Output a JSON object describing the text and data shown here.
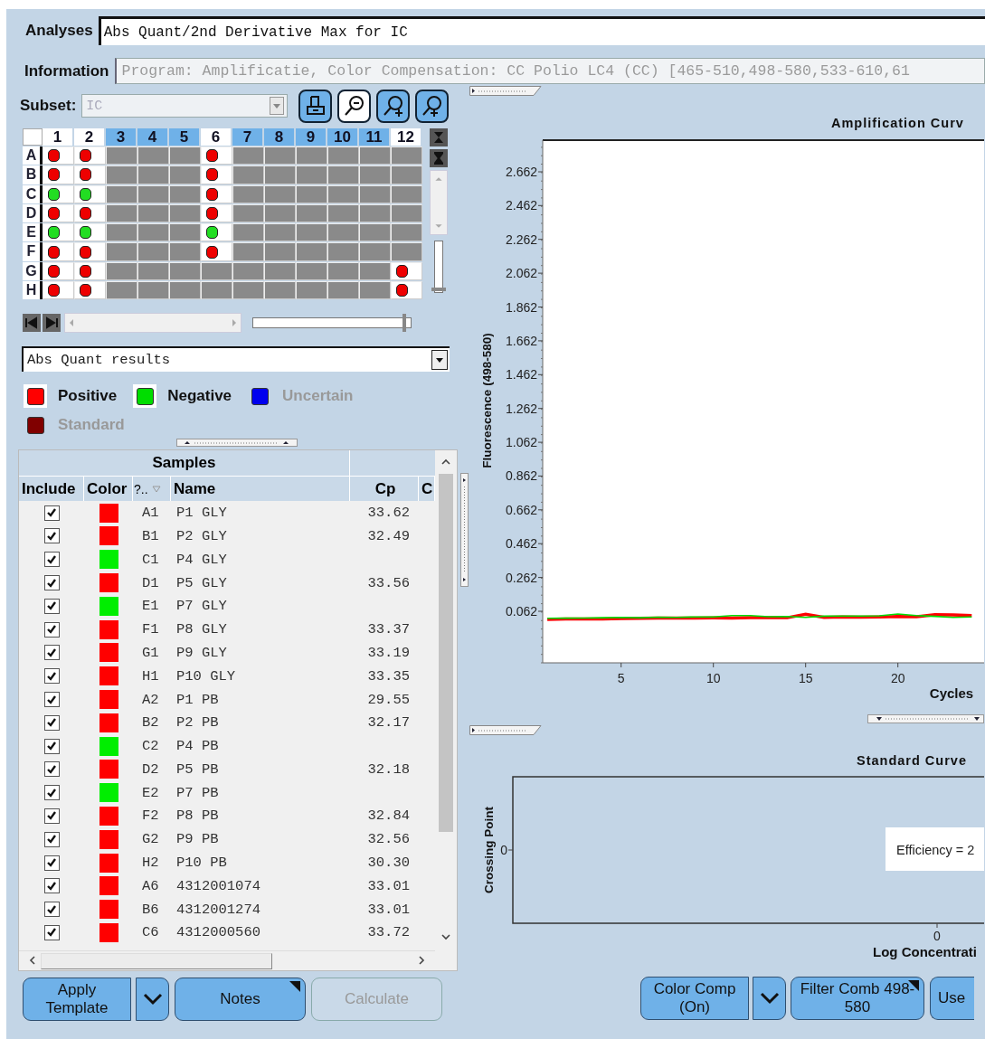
{
  "analyses": {
    "label": "Analyses",
    "value": "Abs Quant/2nd Derivative Max for IC"
  },
  "information": {
    "label": "Information",
    "value": "Program: Amplificatie, Color Compensation: CC Polio LC4 (CC) [465-510,498-580,533-610,61",
    "disabled": true
  },
  "subset": {
    "label": "Subset:",
    "value": "IC",
    "disabled": true
  },
  "toolbar": [
    {
      "kind": "print",
      "selected": false
    },
    {
      "kind": "zoom_out",
      "selected": true
    },
    {
      "kind": "zoom_in",
      "selected": false
    },
    {
      "kind": "zoom_pin",
      "selected": false
    }
  ],
  "plate": {
    "columns": [
      {
        "label": "1",
        "selected": true
      },
      {
        "label": "2",
        "selected": true
      },
      {
        "label": "3",
        "selected": false
      },
      {
        "label": "4",
        "selected": false
      },
      {
        "label": "5",
        "selected": false
      },
      {
        "label": "6",
        "selected": true
      },
      {
        "label": "7",
        "selected": false
      },
      {
        "label": "8",
        "selected": false
      },
      {
        "label": "9",
        "selected": false
      },
      {
        "label": "10",
        "selected": false
      },
      {
        "label": "11",
        "selected": false
      },
      {
        "label": "12",
        "selected": true
      }
    ],
    "rows": [
      {
        "label": "A",
        "wells": [
          {
            "kind": "sample",
            "color": "#ee0000"
          },
          {
            "kind": "sample",
            "color": "#ee0000"
          },
          {
            "kind": "empty"
          },
          {
            "kind": "empty"
          },
          {
            "kind": "empty"
          },
          {
            "kind": "sample",
            "color": "#ee0000"
          },
          {
            "kind": "empty"
          },
          {
            "kind": "empty"
          },
          {
            "kind": "empty"
          },
          {
            "kind": "empty"
          },
          {
            "kind": "empty"
          },
          {
            "kind": "empty"
          }
        ]
      },
      {
        "label": "B",
        "wells": [
          {
            "kind": "sample",
            "color": "#ee0000"
          },
          {
            "kind": "sample",
            "color": "#ee0000"
          },
          {
            "kind": "empty"
          },
          {
            "kind": "empty"
          },
          {
            "kind": "empty"
          },
          {
            "kind": "sample",
            "color": "#ee0000"
          },
          {
            "kind": "empty"
          },
          {
            "kind": "empty"
          },
          {
            "kind": "empty"
          },
          {
            "kind": "empty"
          },
          {
            "kind": "empty"
          },
          {
            "kind": "empty"
          }
        ]
      },
      {
        "label": "C",
        "wells": [
          {
            "kind": "sample",
            "color": "#22dd22"
          },
          {
            "kind": "sample",
            "color": "#22dd22"
          },
          {
            "kind": "empty"
          },
          {
            "kind": "empty"
          },
          {
            "kind": "empty"
          },
          {
            "kind": "sample",
            "color": "#ee0000"
          },
          {
            "kind": "empty"
          },
          {
            "kind": "empty"
          },
          {
            "kind": "empty"
          },
          {
            "kind": "empty"
          },
          {
            "kind": "empty"
          },
          {
            "kind": "empty"
          }
        ]
      },
      {
        "label": "D",
        "wells": [
          {
            "kind": "sample",
            "color": "#ee0000"
          },
          {
            "kind": "sample",
            "color": "#ee0000"
          },
          {
            "kind": "empty"
          },
          {
            "kind": "empty"
          },
          {
            "kind": "empty"
          },
          {
            "kind": "sample",
            "color": "#ee0000"
          },
          {
            "kind": "empty"
          },
          {
            "kind": "empty"
          },
          {
            "kind": "empty"
          },
          {
            "kind": "empty"
          },
          {
            "kind": "empty"
          },
          {
            "kind": "empty"
          }
        ]
      },
      {
        "label": "E",
        "wells": [
          {
            "kind": "sample",
            "color": "#22dd22"
          },
          {
            "kind": "sample",
            "color": "#22dd22"
          },
          {
            "kind": "empty"
          },
          {
            "kind": "empty"
          },
          {
            "kind": "empty"
          },
          {
            "kind": "sample",
            "color": "#22dd22"
          },
          {
            "kind": "empty"
          },
          {
            "kind": "empty"
          },
          {
            "kind": "empty"
          },
          {
            "kind": "empty"
          },
          {
            "kind": "empty"
          },
          {
            "kind": "empty"
          }
        ]
      },
      {
        "label": "F",
        "wells": [
          {
            "kind": "sample",
            "color": "#ee0000"
          },
          {
            "kind": "sample",
            "color": "#ee0000"
          },
          {
            "kind": "empty"
          },
          {
            "kind": "empty"
          },
          {
            "kind": "empty"
          },
          {
            "kind": "sample",
            "color": "#ee0000"
          },
          {
            "kind": "empty"
          },
          {
            "kind": "empty"
          },
          {
            "kind": "empty"
          },
          {
            "kind": "empty"
          },
          {
            "kind": "empty"
          },
          {
            "kind": "empty"
          }
        ]
      },
      {
        "label": "G",
        "wells": [
          {
            "kind": "sample",
            "color": "#ee0000"
          },
          {
            "kind": "sample",
            "color": "#ee0000"
          },
          {
            "kind": "empty"
          },
          {
            "kind": "empty"
          },
          {
            "kind": "empty"
          },
          {
            "kind": "empty"
          },
          {
            "kind": "empty"
          },
          {
            "kind": "empty"
          },
          {
            "kind": "empty"
          },
          {
            "kind": "empty"
          },
          {
            "kind": "empty"
          },
          {
            "kind": "sample",
            "color": "#ee0000"
          }
        ]
      },
      {
        "label": "H",
        "wells": [
          {
            "kind": "sample",
            "color": "#ee0000"
          },
          {
            "kind": "sample",
            "color": "#ee0000"
          },
          {
            "kind": "empty"
          },
          {
            "kind": "empty"
          },
          {
            "kind": "empty"
          },
          {
            "kind": "empty"
          },
          {
            "kind": "empty"
          },
          {
            "kind": "empty"
          },
          {
            "kind": "empty"
          },
          {
            "kind": "empty"
          },
          {
            "kind": "empty"
          },
          {
            "kind": "sample",
            "color": "#ee0000"
          }
        ]
      }
    ],
    "slider": {
      "level": 0.96
    }
  },
  "result_view": {
    "value": "Abs Quant results"
  },
  "legend": [
    {
      "label": "Positive",
      "color": "#ff0000",
      "disabled": false
    },
    {
      "label": "Negative",
      "color": "#00dd00",
      "disabled": false
    },
    {
      "label": "Uncertain",
      "color": "#0000ee",
      "disabled": true
    },
    {
      "label": "Standard",
      "color": "#800000",
      "disabled": true
    }
  ],
  "samples_table": {
    "group_header": "Samples",
    "columns": [
      "Include",
      "Color",
      "?..",
      "Name",
      "Cp",
      "C"
    ],
    "rows": [
      {
        "include": true,
        "color": "#ff0000",
        "position": "A1",
        "name": "P1 GLY",
        "cp": "33.62"
      },
      {
        "include": true,
        "color": "#ff0000",
        "position": "B1",
        "name": "P2 GLY",
        "cp": "32.49"
      },
      {
        "include": true,
        "color": "#00ee00",
        "position": "C1",
        "name": "P4 GLY"
      },
      {
        "include": true,
        "color": "#ff0000",
        "position": "D1",
        "name": "P5 GLY",
        "cp": "33.56"
      },
      {
        "include": true,
        "color": "#00ee00",
        "position": "E1",
        "name": "P7 GLY"
      },
      {
        "include": true,
        "color": "#ff0000",
        "position": "F1",
        "name": "P8 GLY",
        "cp": "33.37"
      },
      {
        "include": true,
        "color": "#ff0000",
        "position": "G1",
        "name": "P9 GLY",
        "cp": "33.19"
      },
      {
        "include": true,
        "color": "#ff0000",
        "position": "H1",
        "name": "P10 GLY",
        "cp": "33.35"
      },
      {
        "include": true,
        "color": "#ff0000",
        "position": "A2",
        "name": "P1 PB",
        "cp": "29.55"
      },
      {
        "include": true,
        "color": "#ff0000",
        "position": "B2",
        "name": "P2 PB",
        "cp": "32.17"
      },
      {
        "include": true,
        "color": "#00ee00",
        "position": "C2",
        "name": "P4 PB"
      },
      {
        "include": true,
        "color": "#ff0000",
        "position": "D2",
        "name": "P5 PB",
        "cp": "32.18"
      },
      {
        "include": true,
        "color": "#00ee00",
        "position": "E2",
        "name": "P7 PB"
      },
      {
        "include": true,
        "color": "#ff0000",
        "position": "F2",
        "name": "P8 PB",
        "cp": "32.84"
      },
      {
        "include": true,
        "color": "#ff0000",
        "position": "G2",
        "name": "P9 PB",
        "cp": "32.56"
      },
      {
        "include": true,
        "color": "#ff0000",
        "position": "H2",
        "name": "P10 PB",
        "cp": "30.30"
      },
      {
        "include": true,
        "color": "#ff0000",
        "position": "A6",
        "name": "4312001074",
        "cp": "33.01"
      },
      {
        "include": true,
        "color": "#ff0000",
        "position": "B6",
        "name": "4312001274",
        "cp": "33.01"
      },
      {
        "include": true,
        "color": "#ff0000",
        "position": "C6",
        "name": "4312000560",
        "cp": "33.72"
      }
    ]
  },
  "left_buttons": [
    {
      "kind": "button",
      "label": "Apply Template",
      "disabled": false,
      "corner": false
    },
    {
      "kind": "menu"
    },
    {
      "kind": "button",
      "label": "Notes",
      "disabled": false,
      "corner": true
    },
    {
      "kind": "button",
      "label": "Calculate",
      "disabled": true,
      "corner": false
    }
  ],
  "amplification_chart": {
    "chart_data": {
      "type": "line",
      "title": "Amplification Curv",
      "xlabel": "Cycles",
      "ylabel": "Fluorescence (498-580)",
      "xlim": [
        0.75,
        24.67
      ],
      "ylim": [
        -0.243,
        2.849
      ],
      "xticks": [
        5,
        10,
        15,
        20
      ],
      "yticks": [
        {
          "value": 0.062,
          "label": "0.062"
        },
        {
          "value": 0.262,
          "label": "0.262"
        },
        {
          "value": 0.462,
          "label": "0.462"
        },
        {
          "value": 0.662,
          "label": "0.662"
        },
        {
          "value": 0.862,
          "label": "0.862"
        },
        {
          "value": 1.062,
          "label": "1.062"
        },
        {
          "value": 1.262,
          "label": "1.262"
        },
        {
          "value": 1.462,
          "label": "1.462"
        },
        {
          "value": 1.662,
          "label": "1.662"
        },
        {
          "value": 1.862,
          "label": "1.862"
        },
        {
          "value": 2.062,
          "label": "2.062"
        },
        {
          "value": 2.262,
          "label": "2.262"
        },
        {
          "value": 2.462,
          "label": "2.462"
        },
        {
          "value": 2.662,
          "label": "2.662"
        }
      ],
      "x": [
        1,
        2,
        3,
        4,
        5,
        6,
        7,
        8,
        9,
        10,
        11,
        12,
        13,
        14,
        15,
        16,
        17,
        18,
        19,
        20,
        21,
        22,
        23,
        24
      ],
      "series": [
        {
          "color": "#ff0000",
          "values": [
            0.014,
            0.016,
            0.017,
            0.017,
            0.019,
            0.02,
            0.021,
            0.021,
            0.022,
            0.023,
            0.022,
            0.024,
            0.025,
            0.024,
            0.045,
            0.026,
            0.028,
            0.027,
            0.029,
            0.031,
            0.03,
            0.042,
            0.04,
            0.036
          ]
        },
        {
          "color": "#00dd00",
          "values": [
            0.02,
            0.021,
            0.022,
            0.024,
            0.026,
            0.024,
            0.027,
            0.026,
            0.028,
            0.029,
            0.036,
            0.037,
            0.03,
            0.031,
            0.026,
            0.033,
            0.034,
            0.034,
            0.035,
            0.046,
            0.036,
            0.032,
            0.026,
            0.028
          ]
        }
      ]
    }
  },
  "standard_chart": {
    "title": "Standard Curve",
    "y_tick": "0",
    "x_tick": "0",
    "xlabel": "Log Concentrati",
    "ylabel": "Crossing Point",
    "annotation": "Efficiency = 2"
  },
  "right_buttons": [
    {
      "kind": "button",
      "label": "Color Comp (On)",
      "disabled": false,
      "corner": false
    },
    {
      "kind": "menu"
    },
    {
      "kind": "button",
      "label": "Filter Comb 498-580",
      "disabled": false,
      "corner": true
    },
    {
      "kind": "cut",
      "label": "Use"
    }
  ]
}
